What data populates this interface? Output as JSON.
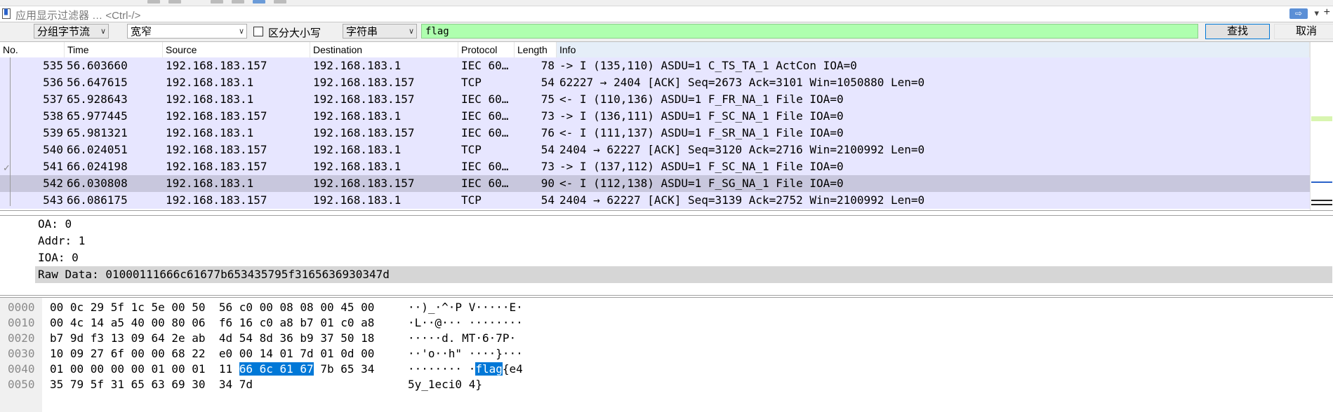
{
  "filter": {
    "placeholder": "应用显示过滤器 … <Ctrl-/>"
  },
  "find": {
    "search_in": "分组字节流",
    "char_width": "宽窄",
    "case_label": "区分大小写",
    "search_type": "字符串",
    "query": "flag",
    "find_label": "查找",
    "cancel_label": "取消"
  },
  "packet_list": {
    "columns": [
      "No.",
      "Time",
      "Source",
      "Destination",
      "Protocol",
      "Length",
      "Info"
    ],
    "rows": [
      {
        "no": "535",
        "time": "56.603660",
        "src": "192.168.183.157",
        "dst": "192.168.183.1",
        "proto": "IEC 60…",
        "len": "78",
        "info": "-> I (135,110) ASDU=1 C_TS_TA_1 ActCon  IOA=0"
      },
      {
        "no": "536",
        "time": "56.647615",
        "src": "192.168.183.1",
        "dst": "192.168.183.157",
        "proto": "TCP",
        "len": "54",
        "info": "62227 → 2404 [ACK] Seq=2673 Ack=3101 Win=1050880 Len=0"
      },
      {
        "no": "537",
        "time": "65.928643",
        "src": "192.168.183.1",
        "dst": "192.168.183.157",
        "proto": "IEC 60…",
        "len": "75",
        "info": "<- I (110,136) ASDU=1 F_FR_NA_1 File    IOA=0"
      },
      {
        "no": "538",
        "time": "65.977445",
        "src": "192.168.183.157",
        "dst": "192.168.183.1",
        "proto": "IEC 60…",
        "len": "73",
        "info": "-> I (136,111) ASDU=1 F_SC_NA_1 File    IOA=0"
      },
      {
        "no": "539",
        "time": "65.981321",
        "src": "192.168.183.1",
        "dst": "192.168.183.157",
        "proto": "IEC 60…",
        "len": "76",
        "info": "<- I (111,137) ASDU=1 F_SR_NA_1 File    IOA=0"
      },
      {
        "no": "540",
        "time": "66.024051",
        "src": "192.168.183.157",
        "dst": "192.168.183.1",
        "proto": "TCP",
        "len": "54",
        "info": "2404 → 62227 [ACK] Seq=3120 Ack=2716 Win=2100992 Len=0"
      },
      {
        "no": "541",
        "time": "66.024198",
        "src": "192.168.183.157",
        "dst": "192.168.183.1",
        "proto": "IEC 60…",
        "len": "73",
        "info": "-> I (137,112) ASDU=1 F_SC_NA_1 File    IOA=0"
      },
      {
        "no": "542",
        "time": "66.030808",
        "src": "192.168.183.1",
        "dst": "192.168.183.157",
        "proto": "IEC 60…",
        "len": "90",
        "info": "<- I (112,138) ASDU=1 F_SG_NA_1 File    IOA=0"
      },
      {
        "no": "543",
        "time": "66.086175",
        "src": "192.168.183.157",
        "dst": "192.168.183.1",
        "proto": "TCP",
        "len": "54",
        "info": "2404 → 62227 [ACK] Seq=3139 Ack=2752 Win=2100992 Len=0"
      }
    ],
    "selected_row": "542",
    "row_color": "#e7e6ff",
    "selected_color": "#c8c7dd"
  },
  "details": {
    "lines": [
      "OA: 0",
      "Addr: 1",
      "IOA: 0"
    ],
    "raw": "Raw Data: 01000111666c61677b653435795f3165636930347d"
  },
  "bytes": {
    "rows": [
      {
        "offset": "0000",
        "hex_a": "00 0c 29 5f 1c 5e 00 50  56 c0 00 08 08 00 45 00",
        "hex_hl": "",
        "hex_b": "",
        "ascii_a": "··)_·^·P V·····E·",
        "ascii_hl": "",
        "ascii_b": ""
      },
      {
        "offset": "0010",
        "hex_a": "00 4c 14 a5 40 00 80 06  f6 16 c0 a8 b7 01 c0 a8",
        "hex_hl": "",
        "hex_b": "",
        "ascii_a": "·L··@··· ········",
        "ascii_hl": "",
        "ascii_b": ""
      },
      {
        "offset": "0020",
        "hex_a": "b7 9d f3 13 09 64 2e ab  4d 54 8d 36 b9 37 50 18",
        "hex_hl": "",
        "hex_b": "",
        "ascii_a": "·····d. MT·6·7P·",
        "ascii_hl": "",
        "ascii_b": ""
      },
      {
        "offset": "0030",
        "hex_a": "10 09 27 6f 00 00 68 22  e0 00 14 01 7d 01 0d 00",
        "hex_hl": "",
        "hex_b": "",
        "ascii_a": "··'o··h\" ····}···",
        "ascii_hl": "",
        "ascii_b": ""
      },
      {
        "offset": "0040",
        "hex_a": "01 00 00 00 00 01 00 01  11 ",
        "hex_hl": "66 6c 61 67",
        "hex_b": " 7b 65 34",
        "ascii_a": "········ ·",
        "ascii_hl": "flag",
        "ascii_b": "{e4"
      },
      {
        "offset": "0050",
        "hex_a": "35 79 5f 31 65 63 69 30  34 7d",
        "hex_hl": "",
        "hex_b": "",
        "ascii_a": "5y_1eci0 4}",
        "ascii_hl": "",
        "ascii_b": ""
      }
    ]
  }
}
